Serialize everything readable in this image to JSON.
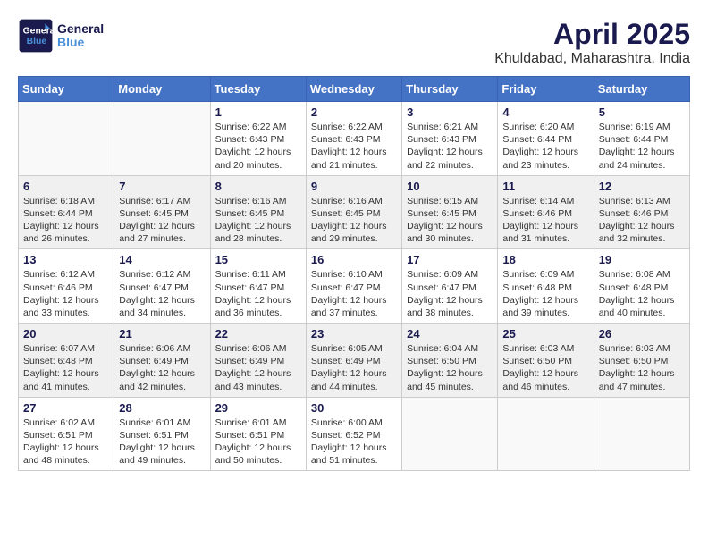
{
  "logo": {
    "line1": "General",
    "line2": "Blue"
  },
  "title": "April 2025",
  "location": "Khuldabad, Maharashtra, India",
  "days_of_week": [
    "Sunday",
    "Monday",
    "Tuesday",
    "Wednesday",
    "Thursday",
    "Friday",
    "Saturday"
  ],
  "weeks": [
    [
      {
        "day": "",
        "info": ""
      },
      {
        "day": "",
        "info": ""
      },
      {
        "day": "1",
        "info": "Sunrise: 6:22 AM\nSunset: 6:43 PM\nDaylight: 12 hours and 20 minutes."
      },
      {
        "day": "2",
        "info": "Sunrise: 6:22 AM\nSunset: 6:43 PM\nDaylight: 12 hours and 21 minutes."
      },
      {
        "day": "3",
        "info": "Sunrise: 6:21 AM\nSunset: 6:43 PM\nDaylight: 12 hours and 22 minutes."
      },
      {
        "day": "4",
        "info": "Sunrise: 6:20 AM\nSunset: 6:44 PM\nDaylight: 12 hours and 23 minutes."
      },
      {
        "day": "5",
        "info": "Sunrise: 6:19 AM\nSunset: 6:44 PM\nDaylight: 12 hours and 24 minutes."
      }
    ],
    [
      {
        "day": "6",
        "info": "Sunrise: 6:18 AM\nSunset: 6:44 PM\nDaylight: 12 hours and 26 minutes."
      },
      {
        "day": "7",
        "info": "Sunrise: 6:17 AM\nSunset: 6:45 PM\nDaylight: 12 hours and 27 minutes."
      },
      {
        "day": "8",
        "info": "Sunrise: 6:16 AM\nSunset: 6:45 PM\nDaylight: 12 hours and 28 minutes."
      },
      {
        "day": "9",
        "info": "Sunrise: 6:16 AM\nSunset: 6:45 PM\nDaylight: 12 hours and 29 minutes."
      },
      {
        "day": "10",
        "info": "Sunrise: 6:15 AM\nSunset: 6:45 PM\nDaylight: 12 hours and 30 minutes."
      },
      {
        "day": "11",
        "info": "Sunrise: 6:14 AM\nSunset: 6:46 PM\nDaylight: 12 hours and 31 minutes."
      },
      {
        "day": "12",
        "info": "Sunrise: 6:13 AM\nSunset: 6:46 PM\nDaylight: 12 hours and 32 minutes."
      }
    ],
    [
      {
        "day": "13",
        "info": "Sunrise: 6:12 AM\nSunset: 6:46 PM\nDaylight: 12 hours and 33 minutes."
      },
      {
        "day": "14",
        "info": "Sunrise: 6:12 AM\nSunset: 6:47 PM\nDaylight: 12 hours and 34 minutes."
      },
      {
        "day": "15",
        "info": "Sunrise: 6:11 AM\nSunset: 6:47 PM\nDaylight: 12 hours and 36 minutes."
      },
      {
        "day": "16",
        "info": "Sunrise: 6:10 AM\nSunset: 6:47 PM\nDaylight: 12 hours and 37 minutes."
      },
      {
        "day": "17",
        "info": "Sunrise: 6:09 AM\nSunset: 6:47 PM\nDaylight: 12 hours and 38 minutes."
      },
      {
        "day": "18",
        "info": "Sunrise: 6:09 AM\nSunset: 6:48 PM\nDaylight: 12 hours and 39 minutes."
      },
      {
        "day": "19",
        "info": "Sunrise: 6:08 AM\nSunset: 6:48 PM\nDaylight: 12 hours and 40 minutes."
      }
    ],
    [
      {
        "day": "20",
        "info": "Sunrise: 6:07 AM\nSunset: 6:48 PM\nDaylight: 12 hours and 41 minutes."
      },
      {
        "day": "21",
        "info": "Sunrise: 6:06 AM\nSunset: 6:49 PM\nDaylight: 12 hours and 42 minutes."
      },
      {
        "day": "22",
        "info": "Sunrise: 6:06 AM\nSunset: 6:49 PM\nDaylight: 12 hours and 43 minutes."
      },
      {
        "day": "23",
        "info": "Sunrise: 6:05 AM\nSunset: 6:49 PM\nDaylight: 12 hours and 44 minutes."
      },
      {
        "day": "24",
        "info": "Sunrise: 6:04 AM\nSunset: 6:50 PM\nDaylight: 12 hours and 45 minutes."
      },
      {
        "day": "25",
        "info": "Sunrise: 6:03 AM\nSunset: 6:50 PM\nDaylight: 12 hours and 46 minutes."
      },
      {
        "day": "26",
        "info": "Sunrise: 6:03 AM\nSunset: 6:50 PM\nDaylight: 12 hours and 47 minutes."
      }
    ],
    [
      {
        "day": "27",
        "info": "Sunrise: 6:02 AM\nSunset: 6:51 PM\nDaylight: 12 hours and 48 minutes."
      },
      {
        "day": "28",
        "info": "Sunrise: 6:01 AM\nSunset: 6:51 PM\nDaylight: 12 hours and 49 minutes."
      },
      {
        "day": "29",
        "info": "Sunrise: 6:01 AM\nSunset: 6:51 PM\nDaylight: 12 hours and 50 minutes."
      },
      {
        "day": "30",
        "info": "Sunrise: 6:00 AM\nSunset: 6:52 PM\nDaylight: 12 hours and 51 minutes."
      },
      {
        "day": "",
        "info": ""
      },
      {
        "day": "",
        "info": ""
      },
      {
        "day": "",
        "info": ""
      }
    ]
  ]
}
